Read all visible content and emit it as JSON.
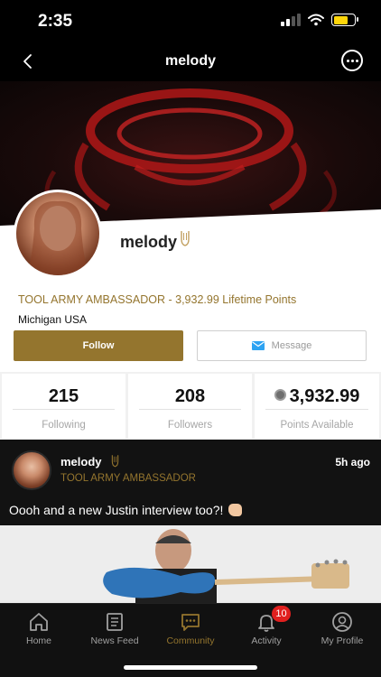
{
  "status": {
    "time": "2:35"
  },
  "nav": {
    "title": "melody"
  },
  "profile": {
    "name": "melody",
    "rank": "TOOL ARMY AMBASSADOR",
    "lifetime_points": "3,932.99 Lifetime Points",
    "location": "Michigan USA",
    "follow_label": "Follow",
    "message_label": "Message"
  },
  "stats": [
    {
      "value": "215",
      "label": "Following"
    },
    {
      "value": "208",
      "label": "Followers"
    },
    {
      "value": "3,932.99",
      "label": "Points Available"
    }
  ],
  "post": {
    "author": "melody",
    "rank": "TOOL ARMY AMBASSADOR",
    "time": "5h ago",
    "text": "Oooh and a new Justin interview too?!"
  },
  "tabs": [
    {
      "label": "Home",
      "icon": "home-icon"
    },
    {
      "label": "News Feed",
      "icon": "newspaper-icon"
    },
    {
      "label": "Community",
      "icon": "chat-bubble-icon"
    },
    {
      "label": "Activity",
      "icon": "bell-icon",
      "badge": "10"
    },
    {
      "label": "My Profile",
      "icon": "user-circle-icon"
    }
  ],
  "colors": {
    "accent": "#94752e",
    "badge": "#e0201f",
    "message_icon": "#2ea3f2"
  }
}
